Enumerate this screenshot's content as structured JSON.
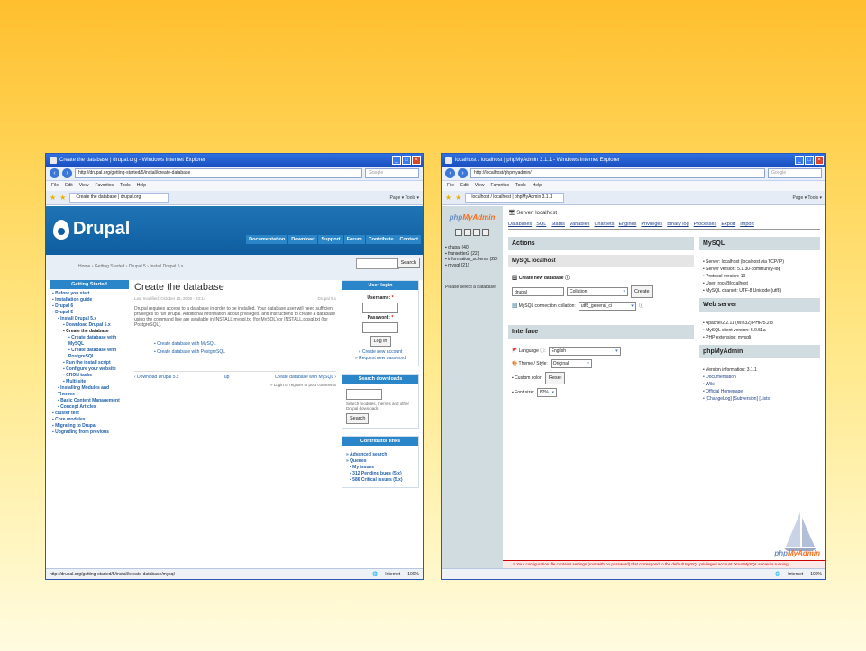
{
  "drupal_window": {
    "title": "Create the database | drupal.org - Windows Internet Explorer",
    "url": "http://drupal.org/getting-started/5/install/create-database",
    "search_placeholder": "Google",
    "menu": [
      "File",
      "Edit",
      "View",
      "Favorites",
      "Tools",
      "Help"
    ],
    "tab": "Create the database | drupal.org",
    "toolbar_right": "Page ▾  Tools ▾",
    "status_url": "http://drupal.org/getting-started/5/install/create-database/mysql",
    "status_zone": "Internet",
    "status_zoom": "100%",
    "page": {
      "logo": "Drupal",
      "nav": [
        "Documentation",
        "Download",
        "Support",
        "Forum",
        "Contribute",
        "Contact"
      ],
      "breadcrumb": "Home › Getting Started › Drupal 5 › Install Drupal 5.x",
      "search_button": "Search",
      "sidebar_title": "Getting Started",
      "sidebar_items": [
        {
          "label": "Before you start",
          "level": 0
        },
        {
          "label": "Installation guide",
          "level": 0
        },
        {
          "label": "Drupal 6",
          "level": 0
        },
        {
          "label": "Drupal 5",
          "level": 0
        },
        {
          "label": "Install Drupal 5.x",
          "level": 1
        },
        {
          "label": "Download Drupal 5.x",
          "level": 2
        },
        {
          "label": "Create the database",
          "level": 2
        },
        {
          "label": "Create database with MySQL",
          "level": 3
        },
        {
          "label": "Create database with PostgreSQL",
          "level": 3
        },
        {
          "label": "Run the install script",
          "level": 2
        },
        {
          "label": "Configure your website",
          "level": 2
        },
        {
          "label": "CRON tasks",
          "level": 2
        },
        {
          "label": "Multi-site",
          "level": 2
        },
        {
          "label": "Installing Modules and Themes",
          "level": 1
        },
        {
          "label": "Basic Content Management",
          "level": 1
        },
        {
          "label": "Concept Articles",
          "level": 1
        },
        {
          "label": "cluster test",
          "level": 0
        },
        {
          "label": "Core modules",
          "level": 0
        },
        {
          "label": "Migrating to Drupal",
          "level": 0
        },
        {
          "label": "Upgrading from previous",
          "level": 0
        }
      ],
      "heading": "Create the database",
      "last_modified": "Last modified: October 15, 2008 - 23:14",
      "version": "Drupal 5.x",
      "body": "Drupal requires access to a database in order to be installed. Your database user will need sufficient privileges to run Drupal. Additional information about privileges, and instructions to create a database using the command line are available in INSTALL.mysql.txt (for MySQL) or INSTALL.pgsql.txt (for PostgreSQL).",
      "links": [
        "Create database with MySQL",
        "Create database with PostgreSQL"
      ],
      "pager_prev": "‹ Download Drupal 5.x",
      "pager_up": "up",
      "pager_next": "Create database with MySQL ›",
      "login_note": "» Login or register to post comments",
      "user_login_title": "User login",
      "username_label": "Username:",
      "password_label": "Password:",
      "login_button": "Log in",
      "create_account": "» Create new account",
      "request_password": "» Request new password",
      "search_downloads_title": "Search downloads",
      "search_downloads_note": "Search modules, themes and other Drupal downloads.",
      "contributor_title": "Contributor links",
      "contributor_links": [
        "Advanced search",
        "Queues",
        "My issues",
        "312 Pending bugs (5.x)",
        "586 Critical issues (5.x)"
      ]
    }
  },
  "pma_window": {
    "title": "localhost / localhost | phpMyAdmin 3.1.1 - Windows Internet Explorer",
    "url": "http://localhost/phpmyadmin/",
    "search_placeholder": "Google",
    "menu": [
      "File",
      "Edit",
      "View",
      "Favorites",
      "Tools",
      "Help"
    ],
    "tab": "localhost / localhost | phpMyAdmin 3.1.1",
    "toolbar_right": "Page ▾  Tools ▾",
    "status_zone": "Internet",
    "status_zoom": "100%",
    "page": {
      "logo_left": "php",
      "logo_right": "MyAdmin",
      "databases": [
        "drupal (40)",
        "fransetter2 (22)",
        "information_schema (28)",
        "mysql (21)"
      ],
      "select_hint": "Please select a database",
      "server": "Server: localhost",
      "tabs": [
        "Databases",
        "SQL",
        "Status",
        "Variables",
        "Charsets",
        "Engines",
        "Privileges",
        "Binary log",
        "Processes",
        "Export",
        "Import"
      ],
      "actions_title": "Actions",
      "mysql_localhost": "MySQL localhost",
      "create_db_label": "Create new database",
      "db_name_value": "drupal",
      "collation_placeholder": "Collation",
      "create_button": "Create",
      "conn_collation_label": "MySQL connection collation:",
      "conn_collation_value": "utf8_general_ci",
      "interface_title": "Interface",
      "language_label": "Language",
      "language_value": "English",
      "theme_label": "Theme / Style:",
      "theme_value": "Original",
      "custom_color_label": "Custom color:",
      "reset_button": "Reset",
      "font_size_label": "Font size:",
      "font_size_value": "82%",
      "mysql_title": "MySQL",
      "mysql_info": [
        "Server: localhost (localhost via TCP/IP)",
        "Server version: 5.1.30-community-log",
        "Protocol version: 10",
        "User: root@localhost",
        "MySQL charset: UTF-8 Unicode (utf8)"
      ],
      "webserver_title": "Web server",
      "webserver_info": [
        "Apache/2.2.11 (Win32) PHP/5.2.8",
        "MySQL client version: 5.0.51a",
        "PHP extension: mysqli"
      ],
      "pma_title": "phpMyAdmin",
      "pma_info": [
        "Version information: 3.1.1",
        "Documentation",
        "Wiki",
        "Official Homepage",
        "[ChangeLog] [Subversion] [Lists]"
      ],
      "warning": "Your configuration file contains settings (root with no password) that correspond to the default MySQL privileged account. Your MySQL server is running"
    }
  }
}
